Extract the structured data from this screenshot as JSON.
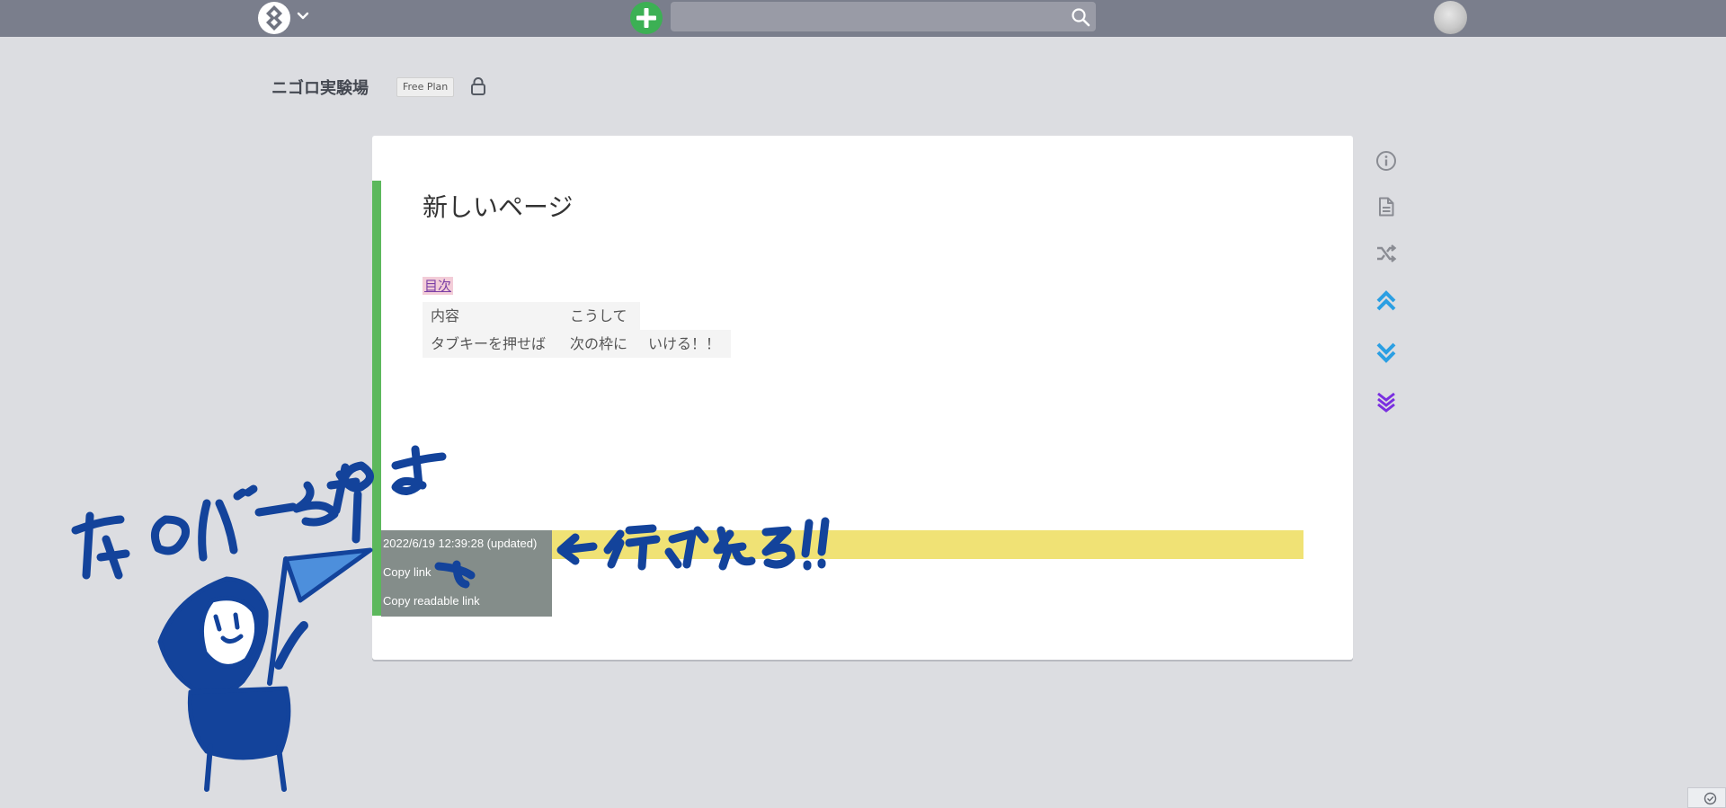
{
  "navbar": {
    "search": {
      "value": "",
      "placeholder": ""
    }
  },
  "project": {
    "title": "ニゴロ実験場",
    "plan_badge": "Free Plan"
  },
  "page": {
    "heading": "新しいページ",
    "toc_link": "目次",
    "table": {
      "rows": [
        [
          "内容",
          "こうして"
        ],
        [
          "タブキーを押せば",
          "次の枠に",
          "いける！！"
        ]
      ]
    },
    "line_menu": {
      "timestamp": "2022/6/19 12:39:28 (updated)",
      "copy_link": "Copy link",
      "copy_readable_link": "Copy readable link"
    }
  },
  "side_actions": [
    {
      "icon": "info-icon",
      "color": "#8a8c93"
    },
    {
      "icon": "document-icon",
      "color": "#8a8c93"
    },
    {
      "icon": "shuffle-icon",
      "color": "#8a8c93"
    },
    {
      "icon": "chevrons-up-icon",
      "color": "#2b9fe3"
    },
    {
      "icon": "chevrons-down-icon",
      "color": "#2b9fe3"
    },
    {
      "icon": "triple-chevron-down-icon",
      "color": "#7a2fe0"
    }
  ],
  "colors": {
    "navbar": "#7a7e8c",
    "background": "#dcdde1",
    "line_bar": "#5cb85c",
    "highlight": "#f0e275",
    "line_menu": "#848d8a",
    "annotation_ink": "#13439b",
    "annotation_fill": "#4d8fdc"
  },
  "annotation": {
    "left_text": "左のバーを押す",
    "right_text": "← 行が光る!!"
  }
}
